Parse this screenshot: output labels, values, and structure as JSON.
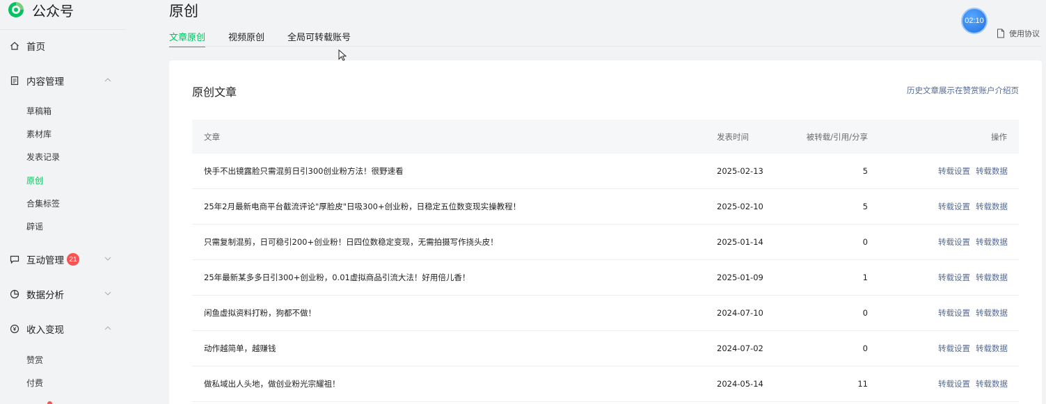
{
  "brand": {
    "name": "公众号"
  },
  "sidebar": {
    "home": "首页",
    "content": {
      "label": "内容管理",
      "items": [
        "草稿箱",
        "素材库",
        "发表记录",
        "原创",
        "合集标签",
        "辟谣"
      ]
    },
    "interaction": {
      "label": "互动管理",
      "badge": "21"
    },
    "analytics": {
      "label": "数据分析"
    },
    "income": {
      "label": "收入变现",
      "items": [
        "赞赏",
        "付费"
      ]
    }
  },
  "page": {
    "title": "原创",
    "tabs": [
      "文章原创",
      "视频原创",
      "全局可转载账号"
    ],
    "timer": "02:10",
    "agreement": "使用协议"
  },
  "card": {
    "title": "原创文章",
    "link": "历史文章展示在赞赏账户介绍页",
    "columns": {
      "article": "文章",
      "date": "发表时间",
      "count": "被转载/引用/分享",
      "ops": "操作"
    },
    "op_settings": "转载设置",
    "op_data": "转载数据",
    "rows": [
      {
        "title": "快手不出镜露脸只需混剪日引300创业粉方法！很野速看",
        "date": "2025-02-13",
        "count": "5"
      },
      {
        "title": "25年2月最新电商平台截流评论\"厚脸皮\"日吸300+创业粉，日稳定五位数变现实操教程！",
        "date": "2025-02-10",
        "count": "5"
      },
      {
        "title": "只需复制混剪，日可稳引200+创业粉！日四位数稳定变现，无需拍摄写作挠头皮！",
        "date": "2025-01-14",
        "count": "0"
      },
      {
        "title": "25年最新某多多日引300+创业粉，0.01虚拟商品引流大法！好用倍儿香！",
        "date": "2025-01-09",
        "count": "1"
      },
      {
        "title": "闲鱼虚拟资料打粉，狗都不做！",
        "date": "2024-07-10",
        "count": "0"
      },
      {
        "title": "动作越简单，越赚钱",
        "date": "2024-07-02",
        "count": "0"
      },
      {
        "title": "做私域出人头地，做创业粉光宗耀祖！",
        "date": "2024-05-14",
        "count": "11"
      }
    ]
  },
  "colors": {
    "accent": "#07c160",
    "link": "#576b95",
    "badge": "#fa5151"
  }
}
